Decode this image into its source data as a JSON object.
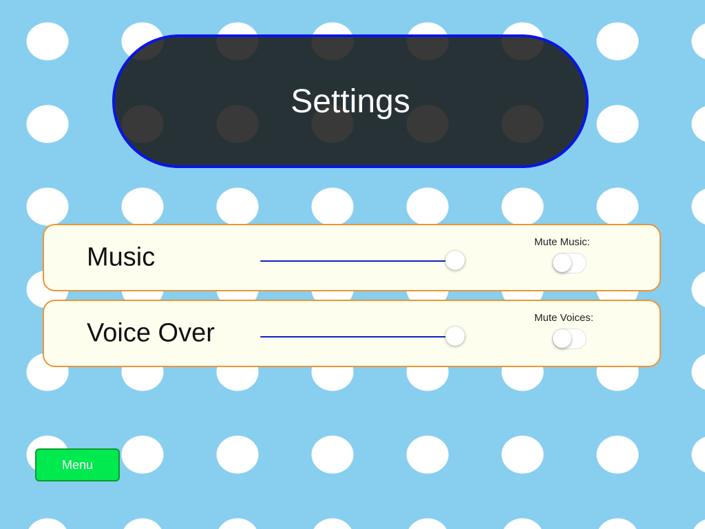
{
  "screen": {
    "title": "Settings",
    "colors": {
      "background": "#87CEEF",
      "dots": "#FFFFFF",
      "title_background": "#1C1C1C",
      "title_border": "#0A14E6",
      "panel_background": "#FEFEEF",
      "panel_border": "#EE9430",
      "slider_fill": "#1020C8",
      "menu_button": "#00E94E",
      "menu_button_border": "#0E9A2E"
    }
  },
  "settings": {
    "music": {
      "label": "Music",
      "volume": 0.95,
      "mute_label": "Mute Music:",
      "muted": false
    },
    "voice_over": {
      "label": "Voice Over",
      "volume": 0.95,
      "mute_label": "Mute Voices:",
      "muted": false
    }
  },
  "menu_button": {
    "label": "Menu"
  }
}
